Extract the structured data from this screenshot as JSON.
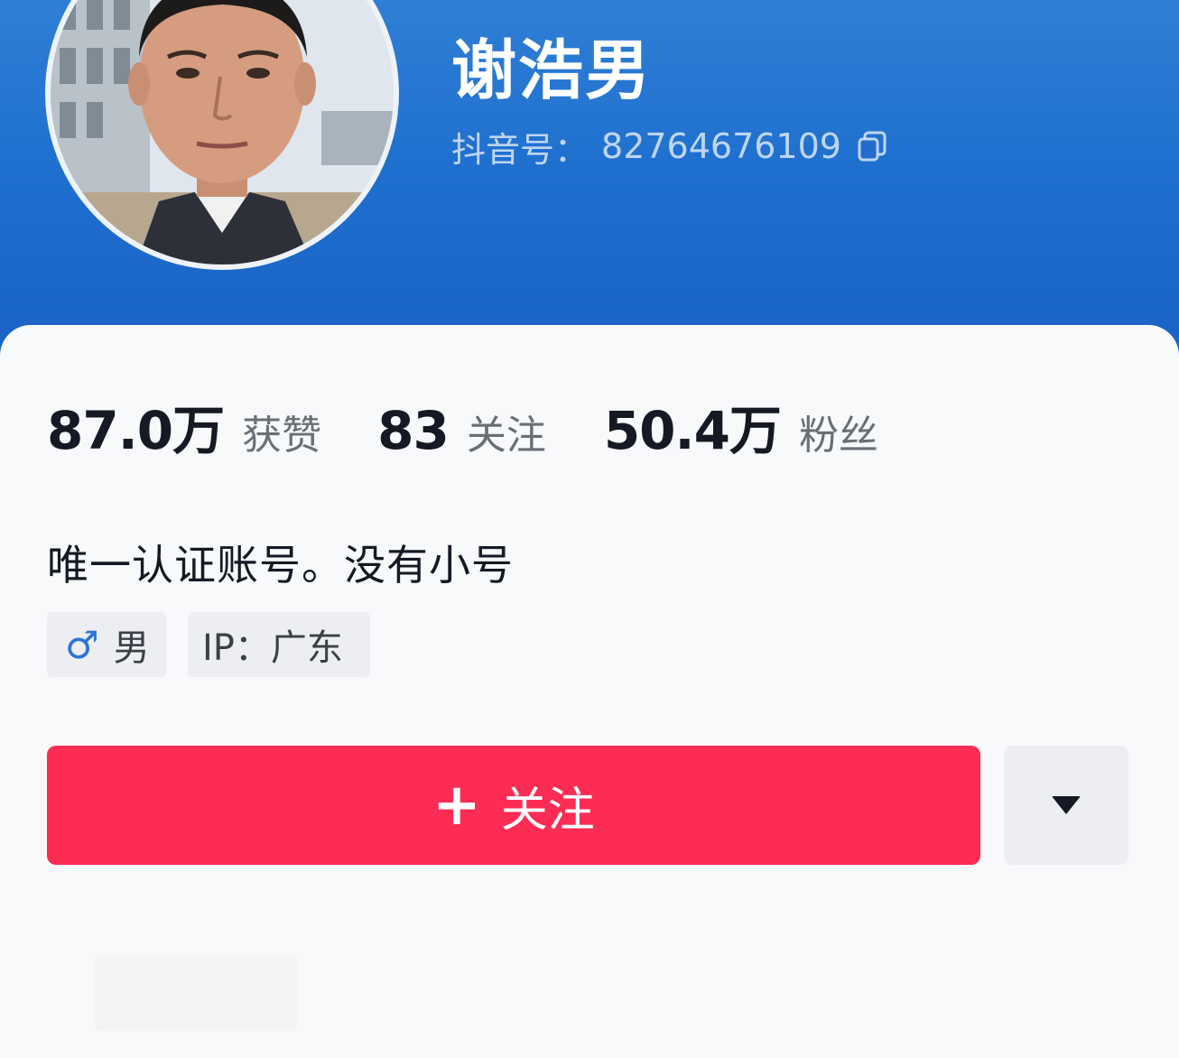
{
  "profile": {
    "name": "谢浩男",
    "account_label": "抖音号：",
    "account_id": "82764676109",
    "avatar_icon": "user-photo-avatar",
    "copy_icon": "copy-icon"
  },
  "stats": {
    "likes_value": "87.0万",
    "likes_label": "获赞",
    "following_value": "83",
    "following_label": "关注",
    "followers_value": "50.4万",
    "followers_label": "粉丝"
  },
  "bio": "唯一认证账号。没有小号",
  "tags": {
    "gender_icon": "♂",
    "gender": "男",
    "ip": "IP：广东"
  },
  "actions": {
    "follow_plus": "+",
    "follow_label": "关注",
    "more_icon": "caret-down-icon"
  },
  "colors": {
    "header_blue": "#1f6fcf",
    "follow_red": "#fd2c55",
    "gender_blue": "#2a74d6"
  }
}
